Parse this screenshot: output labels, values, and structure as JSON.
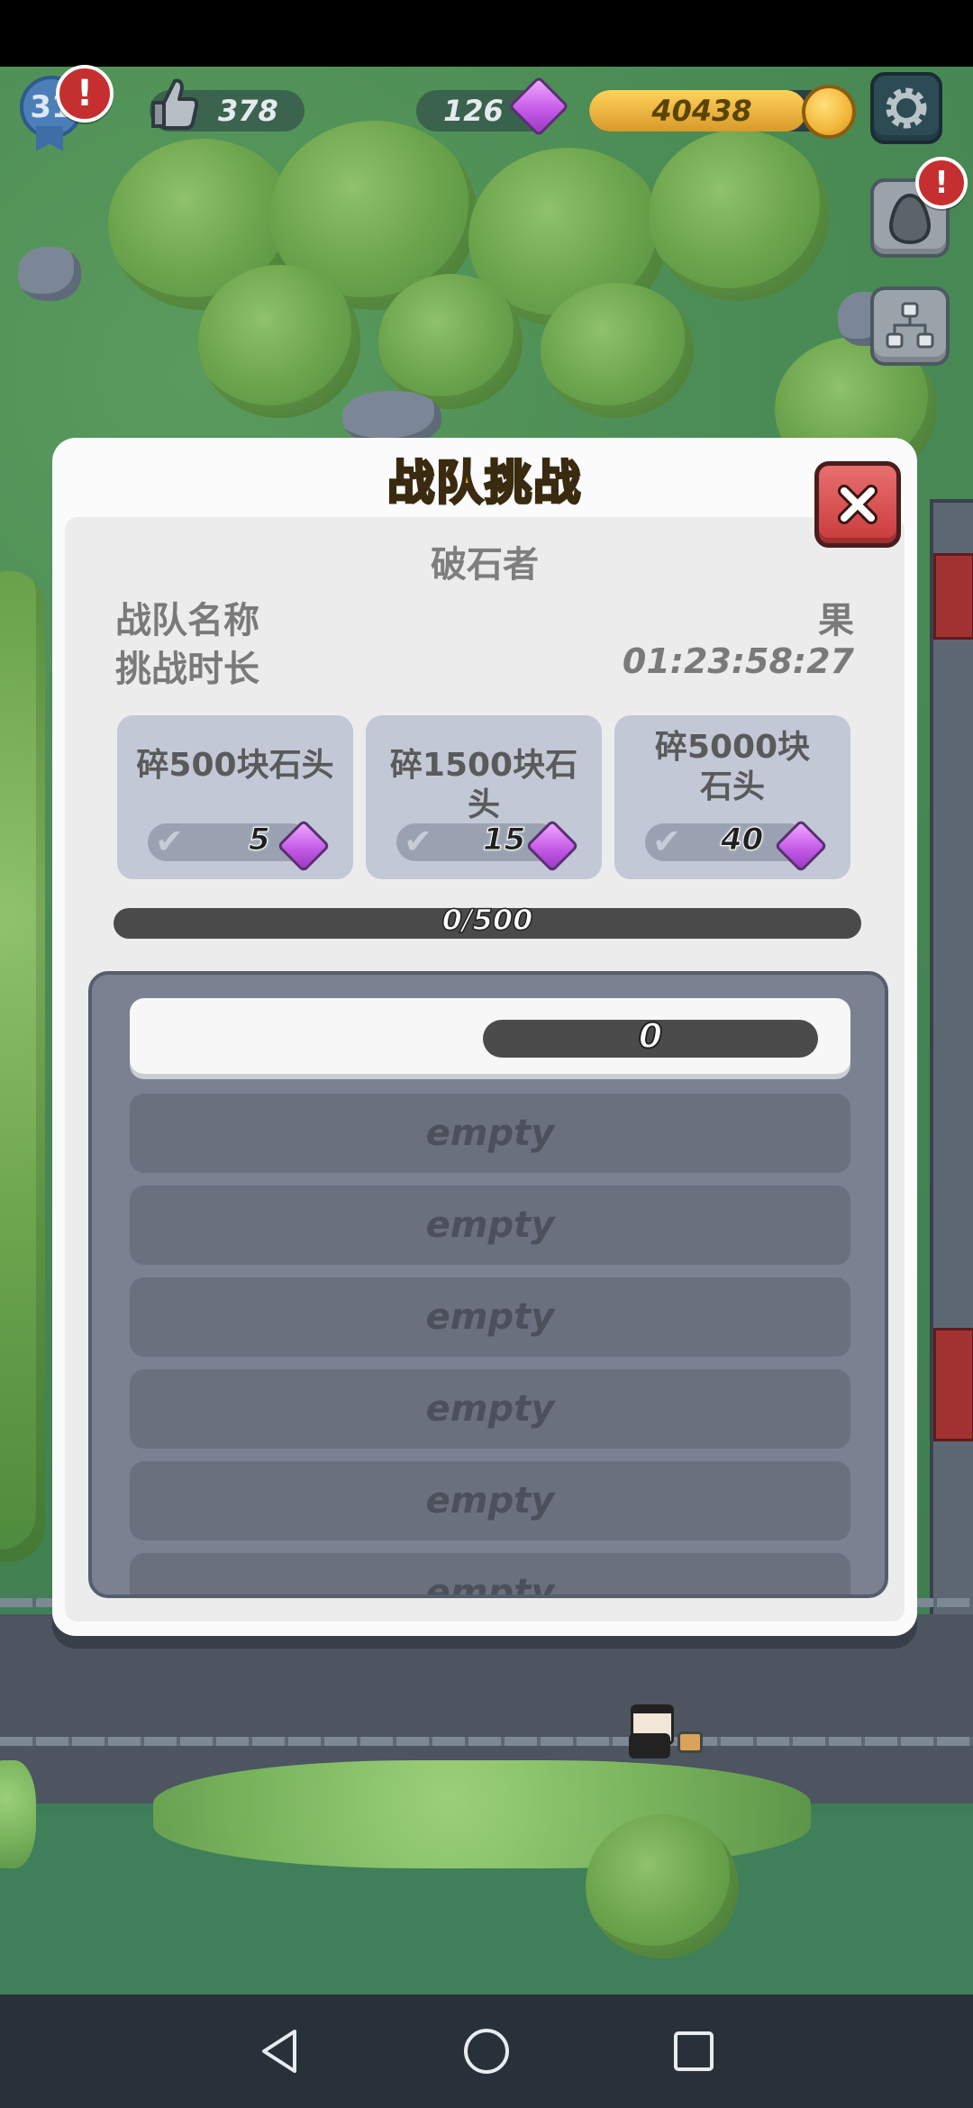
{
  "hud": {
    "level": "31",
    "likes": "378",
    "gems": "126",
    "coins": "40438",
    "coin_fill_fraction": 0.86,
    "alert_mark": "!"
  },
  "dialog": {
    "title": "战队挑战",
    "challenge_name": "破石者",
    "team_name_label": "战队名称",
    "team_name_value": "果",
    "duration_label": "挑战时长",
    "duration_value": "01:23:58:27",
    "tasks": [
      {
        "label": "碎500块石头",
        "reward": "5"
      },
      {
        "label": "碎1500块石头",
        "reward": "15"
      },
      {
        "label": "碎5000块石头",
        "reward": "40"
      }
    ],
    "progress_text": "0/500",
    "progress_fraction": 0,
    "leaderboard": {
      "top_score": "0",
      "empty_label": "empty",
      "empty_count": 6
    }
  },
  "colors": {
    "title_gold": "#f4b42a",
    "close_red": "#c93b3b",
    "gem_purple": "#c65ce8",
    "coin_gold": "#f2b73a"
  },
  "icons": [
    "level-badge-icon",
    "thumbs-up-icon",
    "gem-icon",
    "coin-icon",
    "gear-icon",
    "egg-icon",
    "team-icon",
    "close-icon",
    "check-icon",
    "back-icon",
    "home-icon",
    "recent-apps-icon"
  ]
}
